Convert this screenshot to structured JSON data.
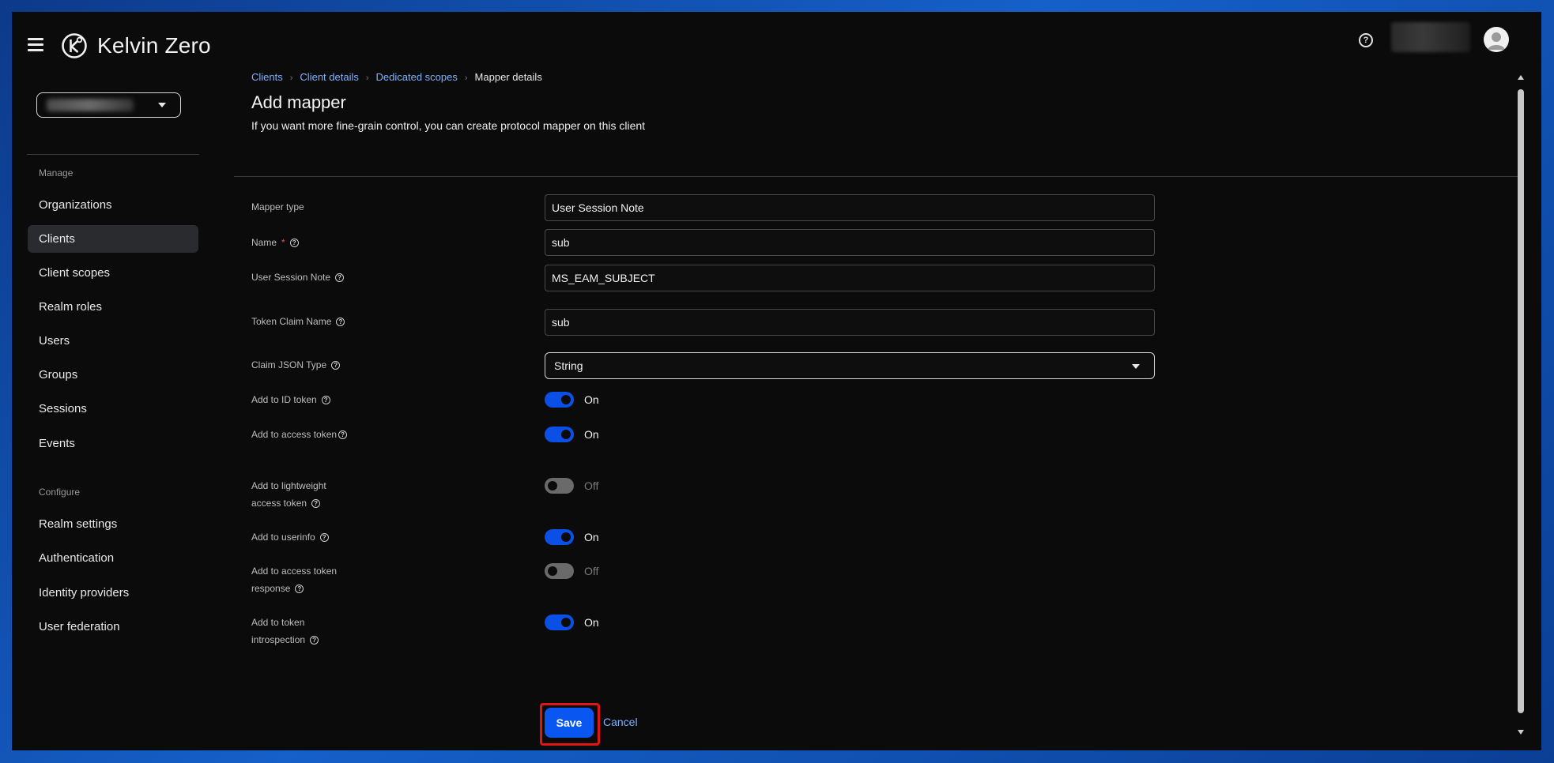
{
  "app": {
    "brand": "Kelvin Zero"
  },
  "header": {
    "help_icon": "?"
  },
  "sidebar": {
    "manage_label": "Manage",
    "configure_label": "Configure",
    "manage_items": [
      {
        "label": "Organizations"
      },
      {
        "label": "Clients",
        "active": true
      },
      {
        "label": "Client scopes"
      },
      {
        "label": "Realm roles"
      },
      {
        "label": "Users"
      },
      {
        "label": "Groups"
      },
      {
        "label": "Sessions"
      },
      {
        "label": "Events"
      }
    ],
    "configure_items": [
      {
        "label": "Realm settings"
      },
      {
        "label": "Authentication"
      },
      {
        "label": "Identity providers"
      },
      {
        "label": "User federation"
      }
    ]
  },
  "breadcrumb": {
    "items": [
      "Clients",
      "Client details",
      "Dedicated scopes"
    ],
    "current": "Mapper details"
  },
  "page": {
    "title": "Add mapper",
    "description": "If you want more fine-grain control, you can create protocol mapper on this client"
  },
  "form": {
    "mapper_type": {
      "label": "Mapper type",
      "value": "User Session Note"
    },
    "name": {
      "label": "Name",
      "required_mark": "*",
      "value": "sub"
    },
    "user_session_note": {
      "label": "User Session Note",
      "value": "MS_EAM_SUBJECT"
    },
    "token_claim_name": {
      "label": "Token Claim Name",
      "value": "sub"
    },
    "claim_json_type": {
      "label": "Claim JSON Type",
      "value": "String"
    },
    "toggles": {
      "id_token": {
        "label": "Add to ID token",
        "state": "On"
      },
      "access_token": {
        "label": "Add to access token",
        "state": "On"
      },
      "lightweight": {
        "label": "Add to lightweight access token",
        "state": "Off"
      },
      "userinfo": {
        "label": "Add to userinfo",
        "state": "On"
      },
      "access_token_response": {
        "label": "Add to access token response",
        "state": "Off"
      },
      "introspection": {
        "label": "Add to token introspection",
        "state": "On"
      }
    },
    "help_glyph": "?",
    "save_label": "Save",
    "cancel_label": "Cancel"
  },
  "colors": {
    "accent": "#0a56f0",
    "link": "#7eb2ff",
    "highlight_frame": "#e01515",
    "background": "#0b0b0c"
  }
}
